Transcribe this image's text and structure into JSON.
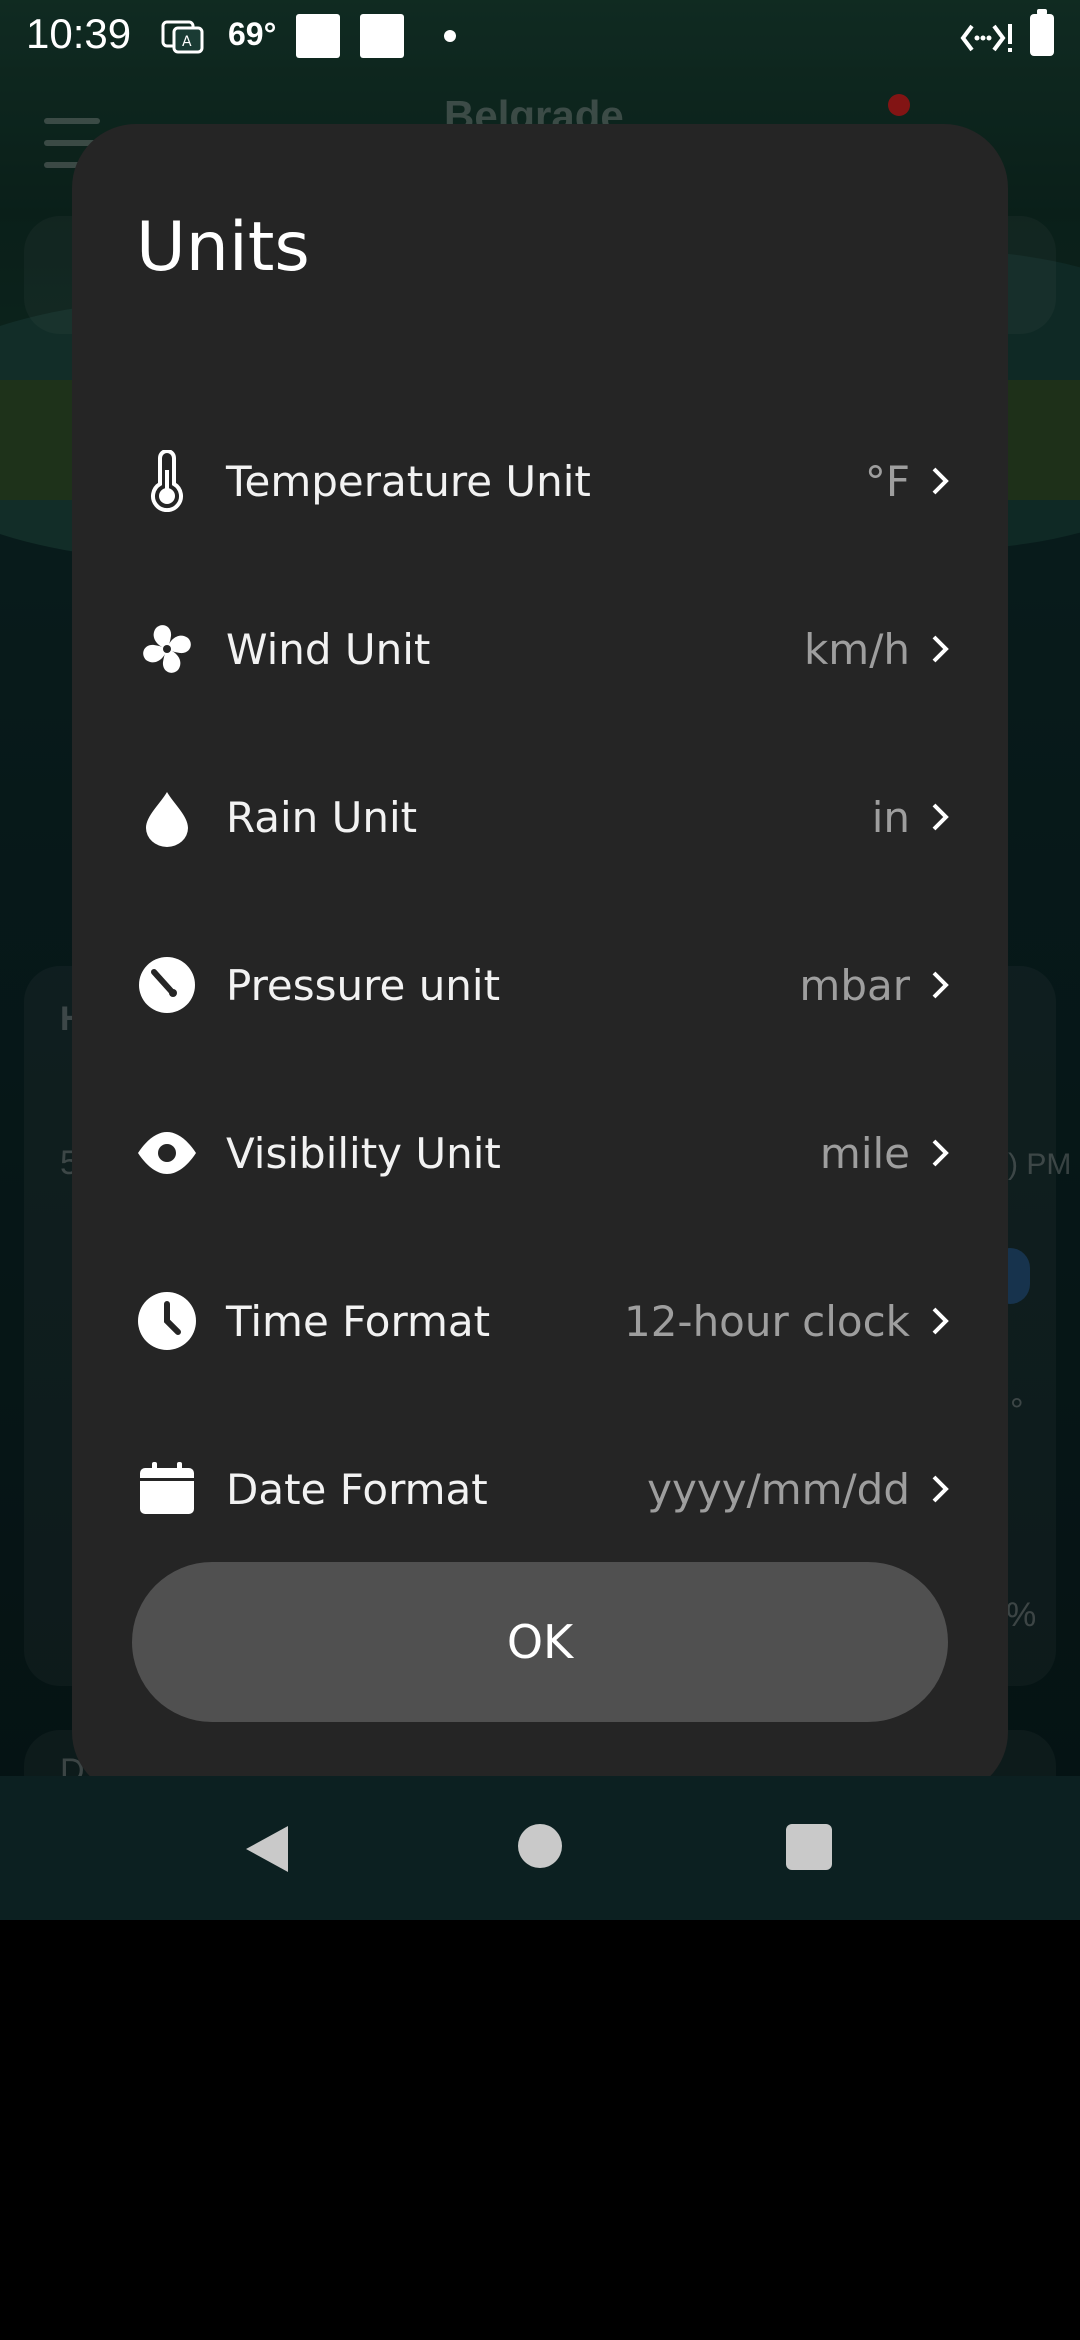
{
  "status_bar": {
    "time": "10:39",
    "temperature": "69°"
  },
  "background_app": {
    "city": "Belgrade",
    "partial_labels": [
      "H",
      "5",
      ") PM",
      "°",
      "%",
      "D"
    ]
  },
  "dialog": {
    "title": "Units",
    "rows": [
      {
        "icon": "thermometer-icon",
        "label": "Temperature Unit",
        "value": "°F"
      },
      {
        "icon": "fan-icon",
        "label": "Wind Unit",
        "value": "km/h"
      },
      {
        "icon": "raindrop-icon",
        "label": "Rain Unit",
        "value": "in"
      },
      {
        "icon": "gauge-icon",
        "label": "Pressure unit",
        "value": "mbar"
      },
      {
        "icon": "eye-icon",
        "label": "Visibility Unit",
        "value": "mile"
      },
      {
        "icon": "clock-icon",
        "label": "Time Format",
        "value": "12-hour clock"
      },
      {
        "icon": "calendar-icon",
        "label": "Date Format",
        "value": "yyyy/mm/dd"
      }
    ],
    "ok_label": "OK"
  },
  "nav_bar": {
    "buttons": [
      "back-icon",
      "home-icon",
      "recents-icon"
    ]
  },
  "colors": {
    "dialog_bg": "#252525",
    "ok_button_bg": "#505050",
    "value_text": "#9e9e9e"
  }
}
